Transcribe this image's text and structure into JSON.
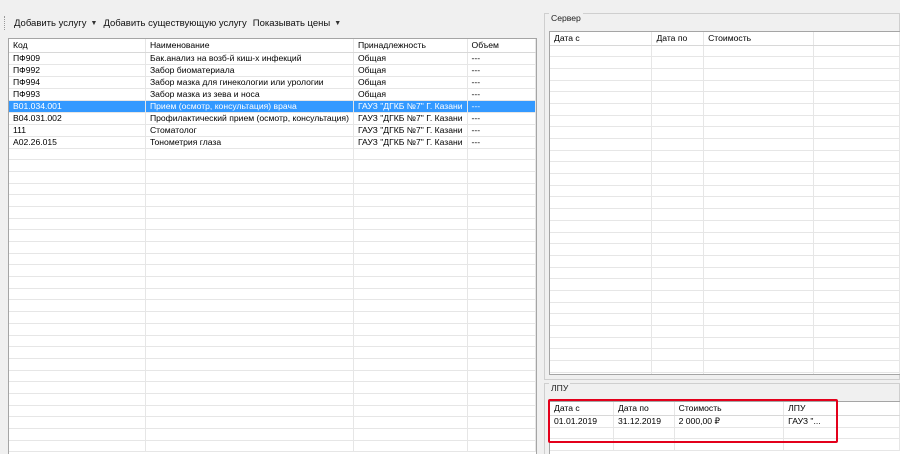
{
  "toolbar": {
    "add_service": "Добавить услугу",
    "add_existing": "Добавить существующую услугу",
    "show_prices": "Показывать цены"
  },
  "services": {
    "columns": [
      "Код",
      "Наименование",
      "Принадлежность",
      "Объем"
    ],
    "rows": [
      [
        "ПФ909",
        "Бак.анализ на возб-й киш-х инфекций",
        "Общая",
        "---"
      ],
      [
        "ПФ992",
        "Забор биоматериала",
        "Общая",
        "---"
      ],
      [
        "ПФ994",
        "Забор мазка для гинекологии или урологии",
        "Общая",
        "---"
      ],
      [
        "ПФ993",
        "Забор мазка из зева и носа",
        "Общая",
        "---"
      ],
      [
        "B01.034.001",
        "Прием (осмотр, консультация) врача",
        "ГАУЗ \"ДГКБ №7\" Г. Казани",
        "---"
      ],
      [
        "B04.031.002",
        "Профилактический прием (осмотр, консультация)",
        "ГАУЗ \"ДГКБ №7\" Г. Казани",
        "---"
      ],
      [
        "111",
        "Стоматолог",
        "ГАУЗ \"ДГКБ №7\" Г. Казани",
        "---"
      ],
      [
        "A02.26.015",
        "Тонометрия глаза",
        "ГАУЗ \"ДГКБ №7\" Г. Казани",
        "---"
      ]
    ],
    "selected_index": 4
  },
  "server": {
    "title": "Сервер",
    "columns": [
      "Дата с",
      "Дата по",
      "Стоимость"
    ]
  },
  "lpu": {
    "title": "ЛПУ",
    "columns": [
      "Дата с",
      "Дата по",
      "Стоимость",
      "ЛПУ"
    ],
    "rows": [
      [
        "01.01.2019",
        "31.12.2019",
        "2 000,00 ₽",
        "ГАУЗ \"..."
      ]
    ]
  },
  "colors": {
    "selection": "#3399ff",
    "highlight": "#e3001b"
  }
}
